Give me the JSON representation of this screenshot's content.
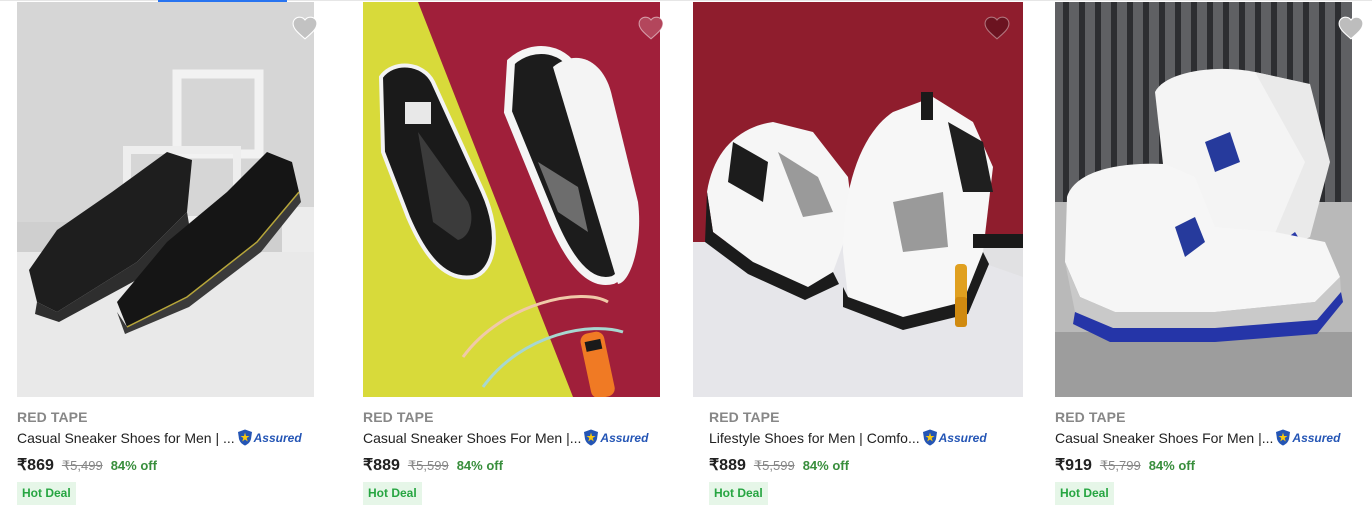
{
  "colors": {
    "accent": "#2874f0",
    "discount": "#388e3c",
    "hot_deal_bg": "#e6f6e8",
    "hot_deal_text": "#26a541",
    "assured": "#2455b5"
  },
  "products": [
    {
      "brand": "RED TAPE",
      "title": "Casual Sneaker Shoes for Men | ...",
      "assured": "Assured",
      "price": "₹869",
      "mrp": "₹5,499",
      "discount": "84% off",
      "badge": "Hot Deal",
      "wishlist_icon": "heart-icon",
      "image": "black-leather-sneakers"
    },
    {
      "brand": "RED TAPE",
      "title": "Casual Sneaker Shoes For Men |...",
      "assured": "Assured",
      "price": "₹889",
      "mrp": "₹5,599",
      "discount": "84% off",
      "badge": "Hot Deal",
      "wishlist_icon": "heart-icon",
      "image": "black-mesh-sneakers"
    },
    {
      "brand": "RED TAPE",
      "title": "Lifestyle Shoes for Men | Comfo...",
      "assured": "Assured",
      "price": "₹889",
      "mrp": "₹5,599",
      "discount": "84% off",
      "badge": "Hot Deal",
      "wishlist_icon": "heart-icon",
      "image": "white-black-sneakers"
    },
    {
      "brand": "RED TAPE",
      "title": "Casual Sneaker Shoes For Men |...",
      "assured": "Assured",
      "price": "₹919",
      "mrp": "₹5,799",
      "discount": "84% off",
      "badge": "Hot Deal",
      "wishlist_icon": "heart-icon",
      "image": "white-high-top-sneakers"
    }
  ]
}
